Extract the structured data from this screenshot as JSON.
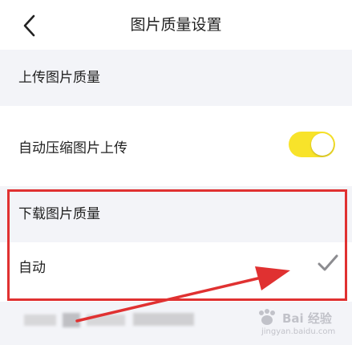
{
  "header": {
    "title": "图片质量设置"
  },
  "upload_section": {
    "title": "上传图片质量",
    "auto_compress_label": "自动压缩图片上传",
    "auto_compress_enabled": true
  },
  "download_section": {
    "title": "下载图片质量",
    "option_label": "自动",
    "option_selected": true
  },
  "watermark": {
    "brand": "Bai 经验",
    "url": "jingyan.baidu.com"
  },
  "colors": {
    "toggle_on": "#f8e32a",
    "annotation_red": "#e03131",
    "check_gray": "#8c8c90"
  }
}
